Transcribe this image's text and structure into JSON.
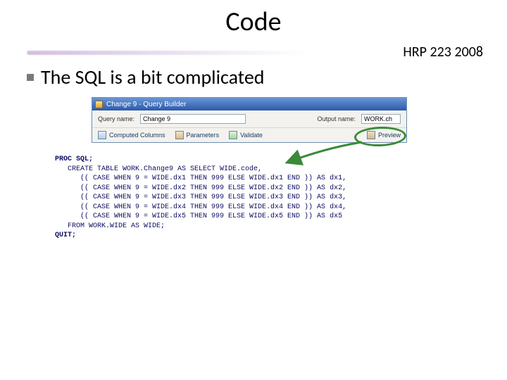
{
  "title": "Code",
  "course_label": "HRP 223 2008",
  "bullet": "The SQL is a bit complicated",
  "qb": {
    "window_title": "Change 9 - Query Builder",
    "query_name_label": "Query name:",
    "query_name_value": "Change 9",
    "output_name_label": "Output name:",
    "output_name_value": "WORK.ch",
    "toolbar": {
      "computed": "Computed Columns",
      "parameters": "Parameters",
      "validate": "Validate",
      "preview": "Preview"
    }
  },
  "sql": {
    "l1": "PROC SQL;",
    "l2": "   CREATE TABLE WORK.Change9 AS SELECT WIDE.code,",
    "l3": "      (( CASE WHEN 9 = WIDE.dx1 THEN 999 ELSE WIDE.dx1 END )) AS dx1,",
    "l4": "      (( CASE WHEN 9 = WIDE.dx2 THEN 999 ELSE WIDE.dx2 END )) AS dx2,",
    "l5": "      (( CASE WHEN 9 = WIDE.dx3 THEN 999 ELSE WIDE.dx3 END )) AS dx3,",
    "l6": "      (( CASE WHEN 9 = WIDE.dx4 THEN 999 ELSE WIDE.dx4 END )) AS dx4,",
    "l7": "      (( CASE WHEN 9 = WIDE.dx5 THEN 999 ELSE WIDE.dx5 END )) AS dx5",
    "l8": "   FROM WORK.WIDE AS WIDE;",
    "l9": "QUIT;"
  }
}
